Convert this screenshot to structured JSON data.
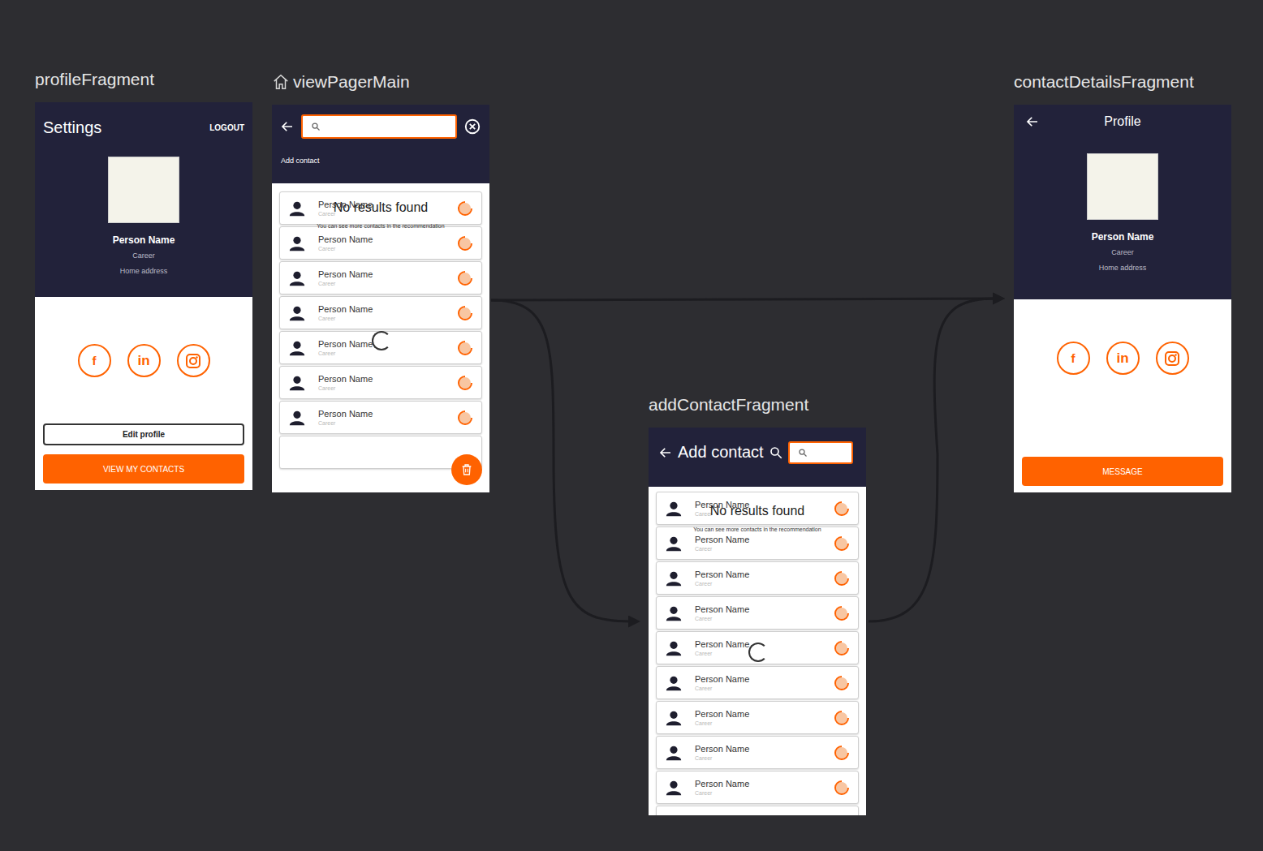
{
  "profileFragment": {
    "label": "profileFragment",
    "title": "Settings",
    "action": "LOGOUT",
    "name": "Person Name",
    "career": "Career",
    "address": "Home address",
    "social": [
      {
        "kind": "facebook",
        "glyph": "f"
      },
      {
        "kind": "linkedin",
        "glyph": "in"
      },
      {
        "kind": "instagram",
        "glyph": ""
      }
    ],
    "buttons": [
      {
        "label": "Edit profile",
        "kind": "outline"
      },
      {
        "label": "VIEW MY CONTACTS",
        "kind": "primary"
      }
    ]
  },
  "viewPagerMain": {
    "label": "viewPagerMain",
    "is_start": true,
    "search": {
      "value": ""
    },
    "tab": "Add contact",
    "loading": true,
    "empty": {
      "title": "No results found",
      "hint": "You can see more contacts in the recommendation"
    },
    "contacts": [
      {
        "name": "Person Name",
        "career": "Career"
      },
      {
        "name": "Person Name",
        "career": "Career"
      },
      {
        "name": "Person Name",
        "career": "Career"
      },
      {
        "name": "Person Name",
        "career": "Career"
      },
      {
        "name": "Person Name",
        "career": "Career"
      },
      {
        "name": "Person Name",
        "career": "Career"
      },
      {
        "name": "Person Name",
        "career": "Career"
      }
    ]
  },
  "addContactFragment": {
    "label": "addContactFragment",
    "title": "Add contact",
    "search": {
      "value": ""
    },
    "loading": true,
    "empty": {
      "title": "No results found",
      "hint": "You can see more contacts in the recommendation"
    },
    "contacts": [
      {
        "name": "Person Name",
        "career": "Career"
      },
      {
        "name": "Person Name",
        "career": "Career"
      },
      {
        "name": "Person Name",
        "career": "Career"
      },
      {
        "name": "Person Name",
        "career": "Career"
      },
      {
        "name": "Person Name",
        "career": "Career"
      },
      {
        "name": "Person Name",
        "career": "Career"
      },
      {
        "name": "Person Name",
        "career": "Career"
      },
      {
        "name": "Person Name",
        "career": "Career"
      },
      {
        "name": "Person Name",
        "career": "Career"
      }
    ]
  },
  "contactDetailsFragment": {
    "label": "contactDetailsFragment",
    "title": "Profile",
    "name": "Person Name",
    "career": "Career",
    "address": "Home address",
    "social": [
      {
        "kind": "facebook",
        "glyph": "f"
      },
      {
        "kind": "linkedin",
        "glyph": "in"
      },
      {
        "kind": "instagram",
        "glyph": ""
      }
    ],
    "button": "MESSAGE"
  },
  "edges": [
    {
      "from": "viewPagerMain",
      "to": "contactDetailsFragment"
    },
    {
      "from": "viewPagerMain",
      "to": "addContactFragment"
    },
    {
      "from": "addContactFragment",
      "to": "contactDetailsFragment"
    }
  ]
}
